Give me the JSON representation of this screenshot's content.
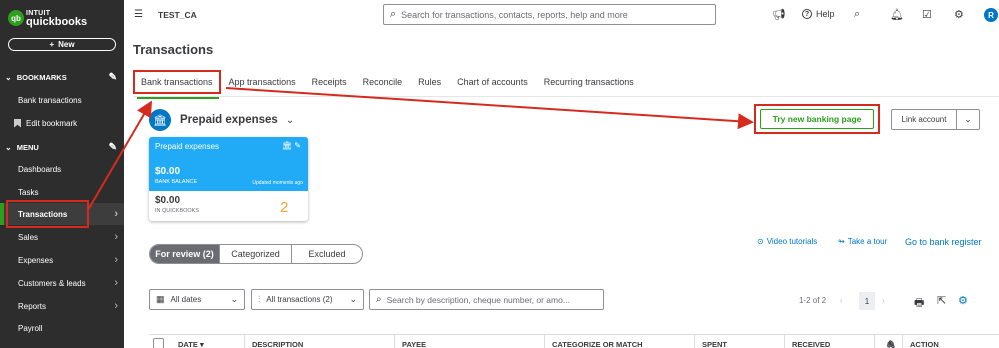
{
  "sidebar": {
    "logo_top": "INTUIT",
    "logo_bottom": "quickbooks",
    "logo_badge": "qb",
    "new_label": "New",
    "bookmarks_label": "BOOKMARKS",
    "menu_label": "MENU",
    "items": [
      {
        "label": "Bank transactions"
      },
      {
        "label": "Edit bookmark"
      },
      {
        "label": "Dashboards"
      },
      {
        "label": "Tasks"
      },
      {
        "label": "Transactions"
      },
      {
        "label": "Sales"
      },
      {
        "label": "Expenses"
      },
      {
        "label": "Customers & leads"
      },
      {
        "label": "Reports"
      },
      {
        "label": "Payroll"
      }
    ]
  },
  "topbar": {
    "company": "TEST_CA",
    "search_placeholder": "Search for transactions, contacts, reports, help and more",
    "help_label": "Help",
    "avatar": "R"
  },
  "page": {
    "title": "Transactions",
    "tabs": [
      {
        "label": "Bank transactions"
      },
      {
        "label": "App transactions"
      },
      {
        "label": "Receipts"
      },
      {
        "label": "Reconcile"
      },
      {
        "label": "Rules"
      },
      {
        "label": "Chart of accounts"
      },
      {
        "label": "Recurring transactions"
      }
    ]
  },
  "account": {
    "name": "Prepaid expenses",
    "card_title": "Prepaid expenses",
    "bank_balance": "$0.00",
    "bank_balance_label": "BANK BALANCE",
    "updated": "Updated moments ago",
    "qb_balance": "$0.00",
    "qb_balance_label": "IN QUICKBOOKS",
    "annotation_number": "2"
  },
  "actions": {
    "try_new": "Try new banking page",
    "link_account": "Link account"
  },
  "review_tabs": [
    {
      "label": "For review (2)"
    },
    {
      "label": "Categorized"
    },
    {
      "label": "Excluded"
    }
  ],
  "links": {
    "video": "Video tutorials",
    "tour": "Take a tour",
    "go_to_register": "Go to bank register"
  },
  "filters": {
    "dates": "All dates",
    "transactions": "All transactions (2)",
    "search_placeholder": "Search by description, cheque number, or amo..."
  },
  "pager": {
    "range": "1-2 of 2",
    "current_page": "1"
  },
  "table": {
    "columns": [
      "DATE",
      "DESCRIPTION",
      "PAYEE",
      "CATEGORIZE OR MATCH",
      "SPENT",
      "RECEIVED",
      "ACTION"
    ]
  },
  "colors": {
    "accent_green": "#2ca01c",
    "annotation_red": "#d52b1e",
    "card_blue": "#21abf6",
    "link_blue": "#0077c5"
  }
}
